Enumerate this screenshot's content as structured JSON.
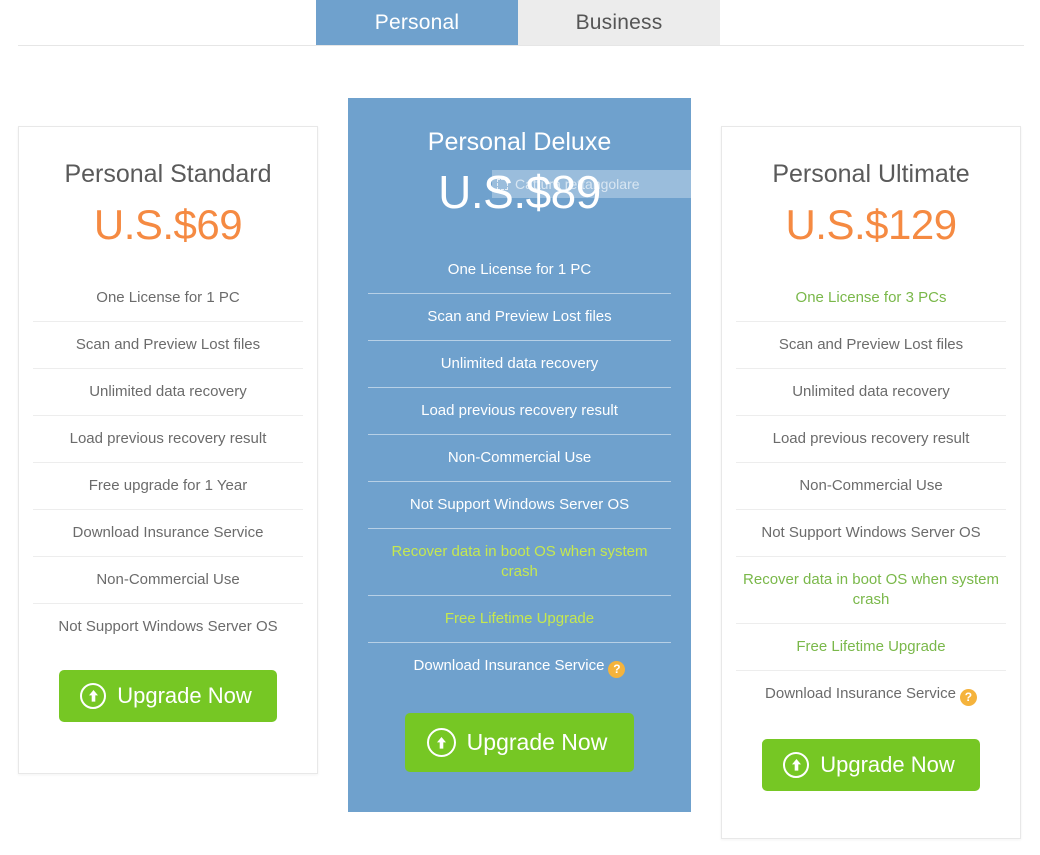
{
  "tabs": [
    {
      "label": "Personal",
      "active": true
    },
    {
      "label": "Business",
      "active": false
    }
  ],
  "overlay": {
    "label": "Cattura rettangolare",
    "icon": "rectangular-snip-icon"
  },
  "colors": {
    "accent_blue": "#6fa1cd",
    "price_orange": "#f58a42",
    "button_green": "#76c724",
    "highlight_green": "#7ab84a",
    "highlight_yellow_green": "#c6e84f",
    "help_badge_orange": "#f5b33c"
  },
  "plans": [
    {
      "id": "personal-standard",
      "title": "Personal Standard",
      "price": "U.S.$69",
      "featured": false,
      "features": [
        {
          "text": "One License for 1 PC",
          "highlight": false,
          "help": false
        },
        {
          "text": "Scan and Preview Lost files",
          "highlight": false,
          "help": false
        },
        {
          "text": "Unlimited data recovery",
          "highlight": false,
          "help": false
        },
        {
          "text": "Load previous recovery result",
          "highlight": false,
          "help": false
        },
        {
          "text": "Free upgrade for 1 Year",
          "highlight": false,
          "help": false
        },
        {
          "text": "Download Insurance Service",
          "highlight": false,
          "help": false
        },
        {
          "text": "Non-Commercial Use",
          "highlight": false,
          "help": false
        },
        {
          "text": "Not Support Windows Server OS",
          "highlight": false,
          "help": false
        }
      ],
      "cta": "Upgrade Now"
    },
    {
      "id": "personal-deluxe",
      "title": "Personal Deluxe",
      "price": "U.S.$89",
      "featured": true,
      "features": [
        {
          "text": "One License for 1 PC",
          "highlight": false,
          "help": false
        },
        {
          "text": "Scan and Preview Lost files",
          "highlight": false,
          "help": false
        },
        {
          "text": "Unlimited data recovery",
          "highlight": false,
          "help": false
        },
        {
          "text": "Load previous recovery result",
          "highlight": false,
          "help": false
        },
        {
          "text": "Non-Commercial Use",
          "highlight": false,
          "help": false
        },
        {
          "text": "Not Support Windows Server OS",
          "highlight": false,
          "help": false
        },
        {
          "text": "Recover data in boot OS when system crash",
          "highlight": true,
          "help": false
        },
        {
          "text": "Free Lifetime Upgrade",
          "highlight": true,
          "help": false
        },
        {
          "text": "Download Insurance Service",
          "highlight": false,
          "help": true
        }
      ],
      "cta": "Upgrade Now"
    },
    {
      "id": "personal-ultimate",
      "title": "Personal Ultimate",
      "price": "U.S.$129",
      "featured": false,
      "features": [
        {
          "text": "One License for 3 PCs",
          "highlight": true,
          "help": false
        },
        {
          "text": "Scan and Preview Lost files",
          "highlight": false,
          "help": false
        },
        {
          "text": "Unlimited data recovery",
          "highlight": false,
          "help": false
        },
        {
          "text": "Load previous recovery result",
          "highlight": false,
          "help": false
        },
        {
          "text": "Non-Commercial Use",
          "highlight": false,
          "help": false
        },
        {
          "text": "Not Support Windows Server OS",
          "highlight": false,
          "help": false
        },
        {
          "text": "Recover data in boot OS when system crash",
          "highlight": true,
          "help": false
        },
        {
          "text": "Free Lifetime Upgrade",
          "highlight": true,
          "help": false
        },
        {
          "text": "Download Insurance Service",
          "highlight": false,
          "help": true
        }
      ],
      "cta": "Upgrade Now"
    }
  ],
  "help_badge_glyph": "?"
}
